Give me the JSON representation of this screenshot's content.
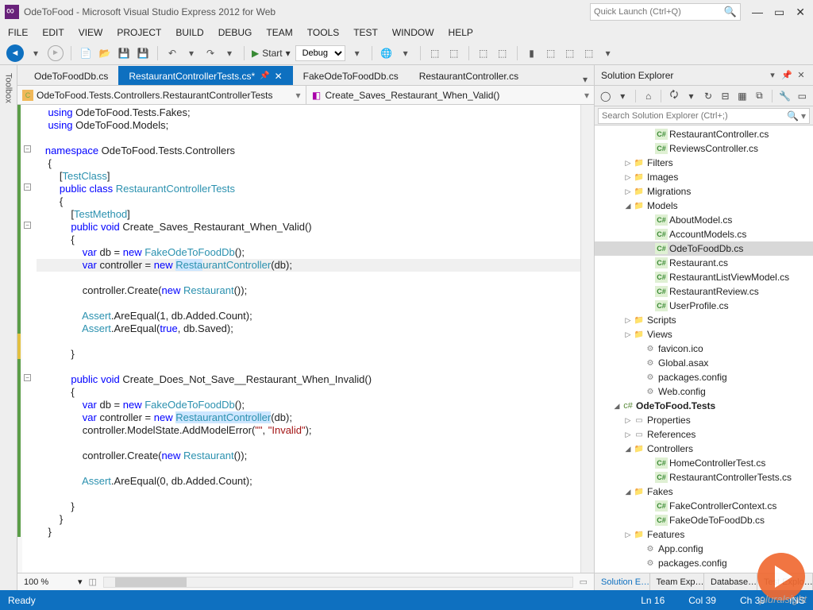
{
  "title": "OdeToFood - Microsoft Visual Studio Express 2012 for Web",
  "quick_launch_placeholder": "Quick Launch (Ctrl+Q)",
  "menu": [
    "FILE",
    "EDIT",
    "VIEW",
    "PROJECT",
    "BUILD",
    "DEBUG",
    "TEAM",
    "TOOLS",
    "TEST",
    "WINDOW",
    "HELP"
  ],
  "toolbar": {
    "start_label": "Start",
    "config": "Debug"
  },
  "tabs": [
    {
      "label": "OdeToFoodDb.cs",
      "active": false
    },
    {
      "label": "RestaurantControllerTests.cs*",
      "active": true
    },
    {
      "label": "FakeOdeToFoodDb.cs",
      "active": false
    },
    {
      "label": "RestaurantController.cs",
      "active": false
    }
  ],
  "nav": {
    "class": "OdeToFood.Tests.Controllers.RestaurantControllerTests",
    "method": "Create_Saves_Restaurant_When_Valid()"
  },
  "code": [
    {
      "t": "    <kw>using</kw> OdeToFood.Tests.Fakes;"
    },
    {
      "t": "    <kw>using</kw> OdeToFood.Models;"
    },
    {
      "t": ""
    },
    {
      "t": "   <kw>namespace</kw> OdeToFood.Tests.Controllers",
      "box": "-"
    },
    {
      "t": "    {"
    },
    {
      "t": "        [<attr>TestClass</attr>]"
    },
    {
      "t": "        <kw>public</kw> <kw>class</kw> <type>RestaurantControllerTests</type>",
      "box": "-"
    },
    {
      "t": "        {"
    },
    {
      "t": "            [<attr>TestMethod</attr>]"
    },
    {
      "t": "            <kw>public</kw> <kw>void</kw> Create_Saves_Restaurant_When_Valid()",
      "box": "-"
    },
    {
      "t": "            {"
    },
    {
      "t": "                <kw>var</kw> db = <kw>new</kw> <type>FakeOdeToFoodDb</type>();"
    },
    {
      "t": "                <kw>var</kw> controller = <kw>new</kw> <type><span class=\"hl\">Resta</span>urantController</type>(db);",
      "cursor": true
    },
    {
      "t": ""
    },
    {
      "t": "                controller.Create(<kw>new</kw> <type>Restaurant</type>());"
    },
    {
      "t": ""
    },
    {
      "t": "                <type>Assert</type>.AreEqual(1, db.Added.Count);"
    },
    {
      "t": "                <type>Assert</type>.AreEqual(<kw>true</kw>, db.Saved);"
    },
    {
      "t": ""
    },
    {
      "t": "            }"
    },
    {
      "t": ""
    },
    {
      "t": "            <kw>public</kw> <kw>void</kw> Create_Does_Not_Save__Restaurant_When_Invalid()",
      "box": "-"
    },
    {
      "t": "            {"
    },
    {
      "t": "                <kw>var</kw> db = <kw>new</kw> <type>FakeOdeToFoodDb</type>();"
    },
    {
      "t": "                <kw>var</kw> controller = <kw>new</kw> <type><span class=\"hl\">RestaurantController</span></type>(db);"
    },
    {
      "t": "                controller.ModelState.AddModelError(<str>\"\"</str>, <str>\"Invalid\"</str>);"
    },
    {
      "t": ""
    },
    {
      "t": "                controller.Create(<kw>new</kw> <type>Restaurant</type>());"
    },
    {
      "t": ""
    },
    {
      "t": "                <type>Assert</type>.AreEqual(0, db.Added.Count);"
    },
    {
      "t": ""
    },
    {
      "t": "            }"
    },
    {
      "t": "        }"
    },
    {
      "t": "    }"
    }
  ],
  "zoom": "100 %",
  "solution_explorer": {
    "title": "Solution Explorer",
    "search_placeholder": "Search Solution Explorer (Ctrl+;)",
    "tree": [
      {
        "d": 4,
        "ic": "cs",
        "lbl": "RestaurantController.cs"
      },
      {
        "d": 4,
        "ic": "cs",
        "lbl": "ReviewsController.cs"
      },
      {
        "d": 2,
        "ar": "r",
        "ic": "fold",
        "lbl": "Filters"
      },
      {
        "d": 2,
        "ar": "r",
        "ic": "fold",
        "lbl": "Images"
      },
      {
        "d": 2,
        "ar": "r",
        "ic": "fold",
        "lbl": "Migrations"
      },
      {
        "d": 2,
        "ar": "d",
        "ic": "fold",
        "lbl": "Models"
      },
      {
        "d": 4,
        "ic": "cs",
        "lbl": "AboutModel.cs"
      },
      {
        "d": 4,
        "ic": "cs",
        "lbl": "AccountModels.cs"
      },
      {
        "d": 4,
        "ic": "cs",
        "lbl": "OdeToFoodDb.cs",
        "sel": true
      },
      {
        "d": 4,
        "ic": "cs",
        "lbl": "Restaurant.cs"
      },
      {
        "d": 4,
        "ic": "cs",
        "lbl": "RestaurantListViewModel.cs"
      },
      {
        "d": 4,
        "ic": "cs",
        "lbl": "RestaurantReview.cs"
      },
      {
        "d": 4,
        "ic": "cs",
        "lbl": "UserProfile.cs"
      },
      {
        "d": 2,
        "ar": "r",
        "ic": "fold",
        "lbl": "Scripts"
      },
      {
        "d": 2,
        "ar": "r",
        "ic": "fold",
        "lbl": "Views"
      },
      {
        "d": 3,
        "ic": "cfg",
        "lbl": "favicon.ico"
      },
      {
        "d": 3,
        "ic": "cfg",
        "lbl": "Global.asax"
      },
      {
        "d": 3,
        "ic": "cfg",
        "lbl": "packages.config"
      },
      {
        "d": 3,
        "ic": "cfg",
        "lbl": "Web.config"
      },
      {
        "d": 1,
        "ar": "d",
        "ic": "proj",
        "lbl": "OdeToFood.Tests",
        "bold": true
      },
      {
        "d": 2,
        "ar": "r",
        "ic": "ref",
        "lbl": "Properties"
      },
      {
        "d": 2,
        "ar": "r",
        "ic": "ref",
        "lbl": "References"
      },
      {
        "d": 2,
        "ar": "d",
        "ic": "fold",
        "lbl": "Controllers"
      },
      {
        "d": 4,
        "ic": "cs",
        "lbl": "HomeControllerTest.cs"
      },
      {
        "d": 4,
        "ic": "cs",
        "lbl": "RestaurantControllerTests.cs"
      },
      {
        "d": 2,
        "ar": "d",
        "ic": "fold",
        "lbl": "Fakes"
      },
      {
        "d": 4,
        "ic": "cs",
        "lbl": "FakeControllerContext.cs"
      },
      {
        "d": 4,
        "ic": "cs",
        "lbl": "FakeOdeToFoodDb.cs"
      },
      {
        "d": 2,
        "ar": "r",
        "ic": "fold",
        "lbl": "Features"
      },
      {
        "d": 3,
        "ic": "cfg",
        "lbl": "App.config"
      },
      {
        "d": 3,
        "ic": "cfg",
        "lbl": "packages.config"
      }
    ],
    "bottom_tabs": [
      "Solution E…",
      "Team Exp…",
      "Database…",
      "Test Explo…"
    ]
  },
  "statusbar": {
    "ready": "Ready",
    "ln": "Ln 16",
    "col": "Col 39",
    "ch": "Ch 39",
    "ins": "INS"
  },
  "watermark": "pluralsight"
}
